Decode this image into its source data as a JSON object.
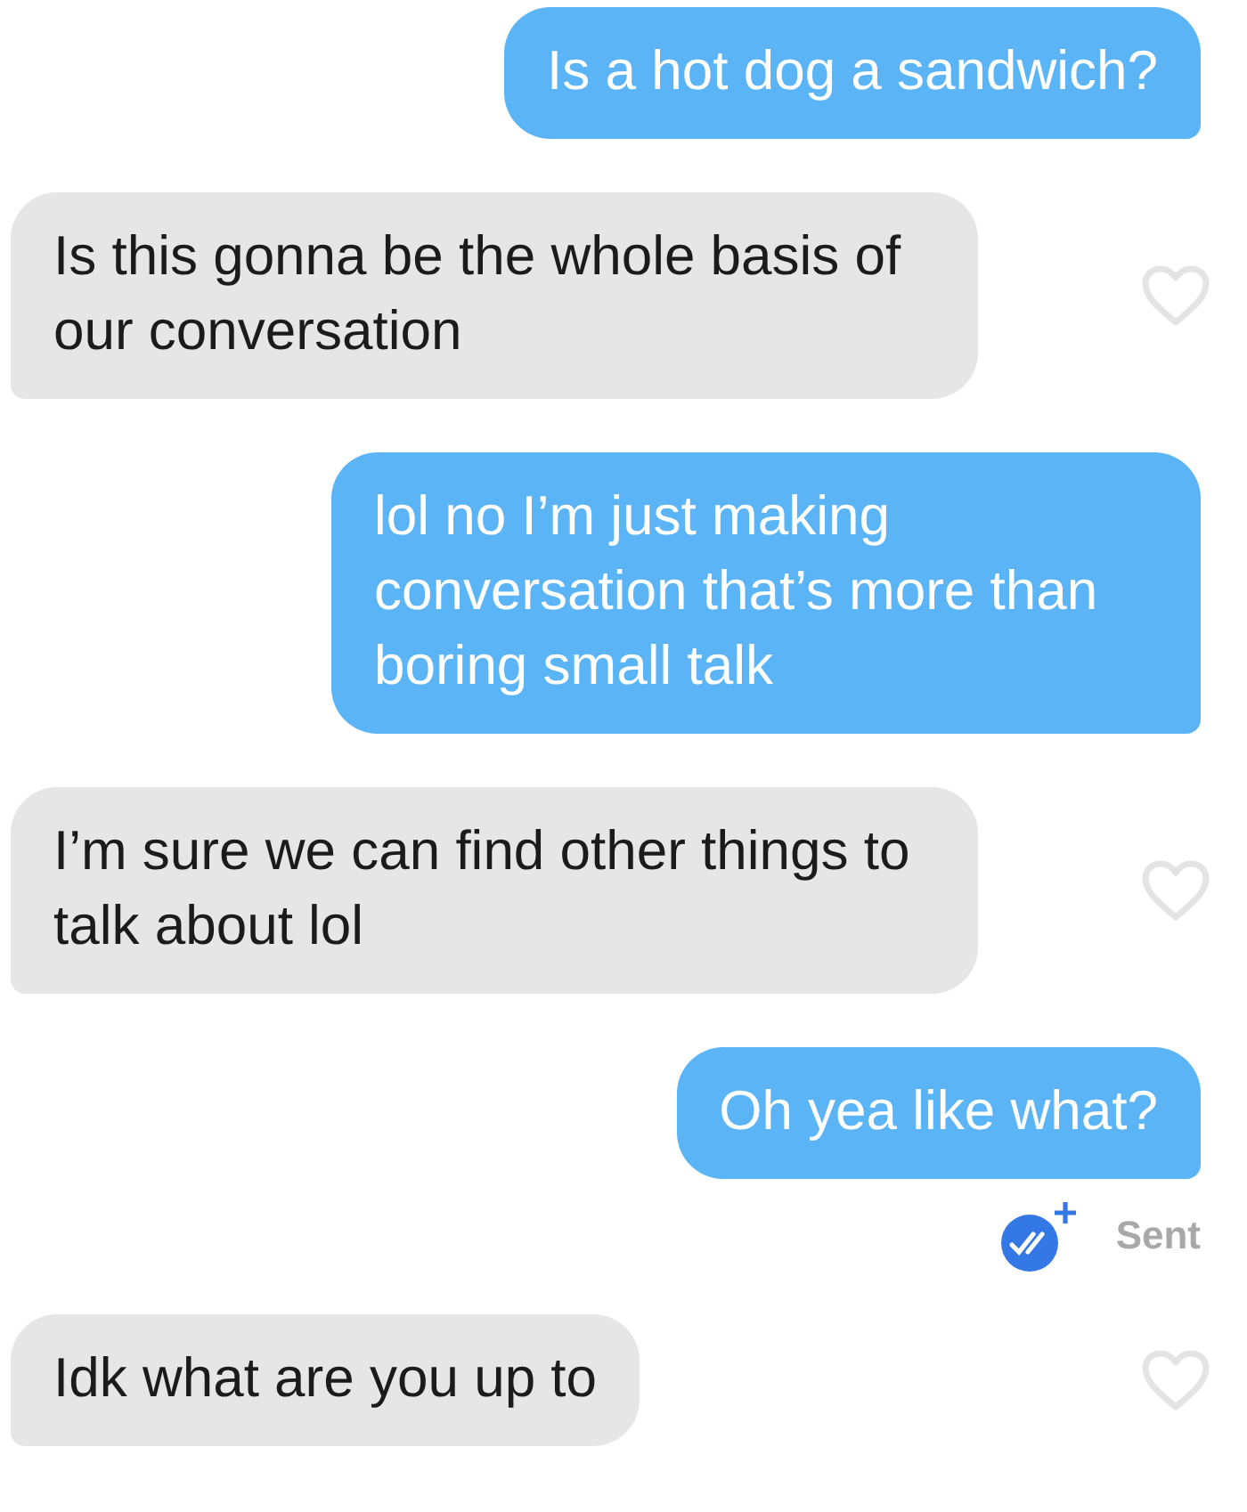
{
  "messages": [
    {
      "kind": "sent",
      "text": "Is a hot dog a sandwich?"
    },
    {
      "kind": "received",
      "text": "Is this gonna be the whole basis of our conversation",
      "liked": false
    },
    {
      "kind": "sent",
      "text": "lol no I’m just making conversation that’s more than boring small talk"
    },
    {
      "kind": "received",
      "text": "I’m sure we can find other things to talk about lol",
      "liked": false
    },
    {
      "kind": "sent",
      "text": "Oh yea like what?",
      "status": "Sent"
    },
    {
      "kind": "received",
      "text": "Idk what are you up to",
      "liked": false
    }
  ]
}
